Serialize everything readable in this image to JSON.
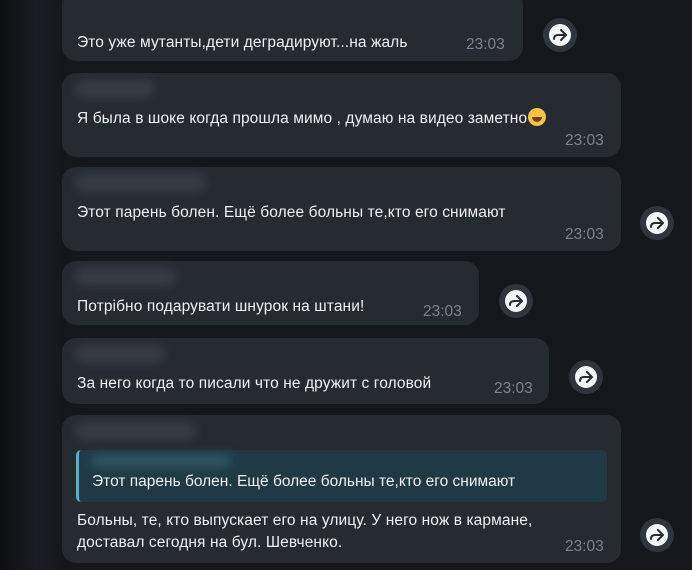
{
  "messages": [
    {
      "text": "Это уже мутанты,дети деградируют...на жаль",
      "time": "23:03"
    },
    {
      "text": "Я была в шоке когда прошла мимо , думаю на видео заметно",
      "emoji": "laughing-tears-emoji",
      "time": "23:03"
    },
    {
      "text": "Этот парень болен. Ещё более больны те,кто его снимают",
      "time": "23:03"
    },
    {
      "text": "Потрібно подарувати шнурок на штани!",
      "time": "23:03"
    },
    {
      "text": "За него когда то писали что не дружит с головой",
      "time": "23:03"
    },
    {
      "reply_quote": "Этот парень болен. Ещё более больны те,кто его снимают",
      "text_line1": "Больны, те, кто выпускает его на улицу. У него нож в кармане,",
      "text_line2": "доставал сегодня на бул. Шевченко.",
      "time": "23:03"
    }
  ],
  "icons": {
    "forward": "forward-arrow-icon"
  },
  "colors": {
    "bubble": "#262a31",
    "background": "#14171c",
    "quote_accent": "#4fb4c6",
    "time": "#7c838c"
  }
}
